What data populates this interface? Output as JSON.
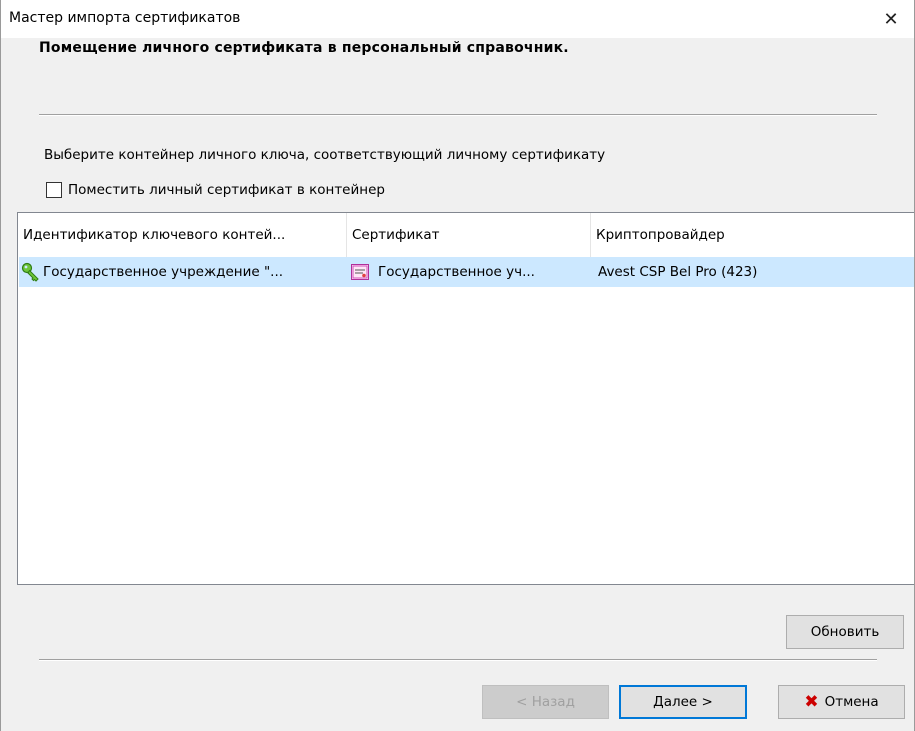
{
  "window": {
    "title": "Мастер импорта сертификатов",
    "close_glyph": "✕"
  },
  "header": {
    "heading": "Помещение личного сертификата в персональный справочник."
  },
  "content": {
    "description": "Выберите контейнер личного ключа, соответствующий личному сертификату",
    "checkbox_label": "Поместить личный сертификат в контейнер",
    "checkbox_checked": false
  },
  "list": {
    "columns": [
      "Идентификатор ключевого контей...",
      "Сертификат",
      "Криптопровайдер"
    ],
    "rows": [
      {
        "container": "Государственное учреждение \"...",
        "certificate": "Государственное уч...",
        "provider": "Avest CSP Bel Pro (423)",
        "key_icon": "key-icon",
        "cert_icon": "certificate-icon",
        "selected": true
      }
    ]
  },
  "buttons": {
    "refresh": "Обновить",
    "back": "< Назад",
    "next": "Далее >",
    "cancel": "Отмена",
    "cancel_icon": "red-x-icon"
  },
  "colors": {
    "selection": "#cce8ff",
    "accent": "#0078d7",
    "cancel_x": "#cc0000"
  }
}
